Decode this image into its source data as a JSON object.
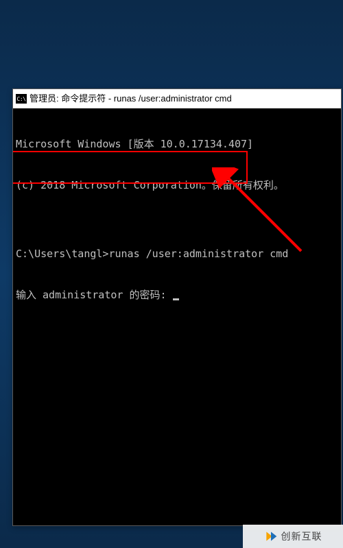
{
  "window": {
    "icon_label": "C:\\",
    "title": "管理员: 命令提示符 - runas  /user:administrator cmd"
  },
  "terminal": {
    "line1": "Microsoft Windows [版本 10.0.17134.407]",
    "line2": "(c) 2018 Microsoft Corporation。保留所有权利。",
    "blank": "",
    "line3_prompt": "C:\\Users\\tangl>",
    "line3_cmd": "runas /user:administrator cmd",
    "line4": "输入 administrator 的密码: "
  },
  "annotation": {
    "highlight_target": "password-prompt"
  },
  "watermark": {
    "text": "创新互联"
  }
}
